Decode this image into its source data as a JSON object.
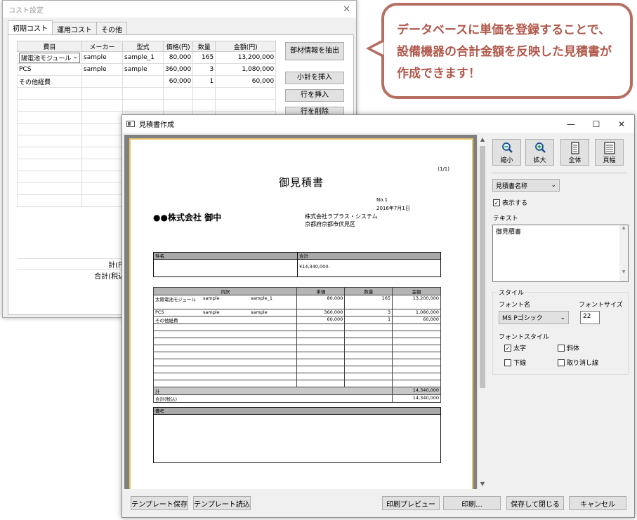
{
  "cost_window": {
    "title": "コスト設定",
    "tabs": [
      "初期コスト",
      "運用コスト",
      "その他"
    ],
    "columns": [
      "費目",
      "メーカー",
      "型式",
      "価格(円)",
      "数量",
      "金額(円)"
    ],
    "rows": [
      {
        "item": "陽電池モジュール",
        "maker": "sample",
        "model": "sample_1",
        "price": "80,000",
        "qty": "165",
        "amount": "13,200,000"
      },
      {
        "item": "PCS",
        "maker": "sample",
        "model": "sample",
        "price": "360,000",
        "qty": "3",
        "amount": "1,080,000"
      },
      {
        "item": "その他経費",
        "maker": "",
        "model": "",
        "price": "60,000",
        "qty": "1",
        "amount": "60,000"
      }
    ],
    "buttons": {
      "extract": "部材情報を抽出",
      "subtotal": "小計を挿入",
      "insert_row": "行を挿入",
      "delete_row": "行を削除"
    },
    "subtotal_label": "計(円)",
    "total_tax_label": "合計(税込)"
  },
  "callout": {
    "text": "データベースに単価を登録することで、設備機器の合計金額を反映した見積書が作成できます！",
    "color": "#b0584b",
    "border_color": "#b76e62"
  },
  "estimate_window": {
    "title": "見積書作成",
    "controls": {
      "minimize": "—",
      "maximize": "☐",
      "close": "✕"
    },
    "preview": {
      "page_no": "(1/1)",
      "doc_title": "御見積書",
      "doc_number": "No.1",
      "doc_date": "2016年7月1日",
      "customer": "●●株式会社 御中",
      "issuer_company": "株式会社ラプラス・システム",
      "issuer_address": "京都府京都市伏見区",
      "subject_label": "件名",
      "total_label": "合計",
      "total_value": "¥14,340,000-",
      "table_headers": [
        "内訳",
        "単価",
        "数量",
        "金額"
      ],
      "items": [
        {
          "name": "太陽電池モジュール",
          "maker": "sample",
          "model": "sample_1",
          "price": "80,000",
          "qty": "165",
          "amount": "13,200,000"
        },
        {
          "name": "PCS",
          "maker": "sample",
          "model": "sample",
          "price": "360,000",
          "qty": "3",
          "amount": "1,080,000"
        },
        {
          "name": "その他経費",
          "maker": "",
          "model": "",
          "price": "60,000",
          "qty": "1",
          "amount": "60,000"
        }
      ],
      "subtotal_label": "計",
      "subtotal_value": "14,340,000",
      "grand_label": "合計(税込)",
      "grand_value": "14,340,000",
      "notes_label": "備考"
    },
    "panel": {
      "tools": [
        "縮小",
        "拡大",
        "全体",
        "頁幅"
      ],
      "field_select": "見積書名称",
      "show_label": "表示する",
      "show_checked": true,
      "text_label": "テキスト",
      "text_value": "御見積書",
      "style_label": "スタイル",
      "font_name_label": "フォント名",
      "font_name_value": "MS Pゴシック",
      "font_size_label": "フォントサイズ",
      "font_size_value": "22",
      "font_style_label": "フォントスタイル",
      "bold_label": "太字",
      "bold_checked": true,
      "italic_label": "斜体",
      "italic_checked": false,
      "underline_label": "下線",
      "underline_checked": false,
      "strike_label": "取り消し線",
      "strike_checked": false
    },
    "bottom_buttons": {
      "save_template": "テンプレート保存",
      "load_template": "テンプレート読込",
      "print_preview": "印刷プレビュー",
      "print": "印刷...",
      "save_close": "保存して閉じる",
      "cancel": "キャンセル"
    }
  }
}
